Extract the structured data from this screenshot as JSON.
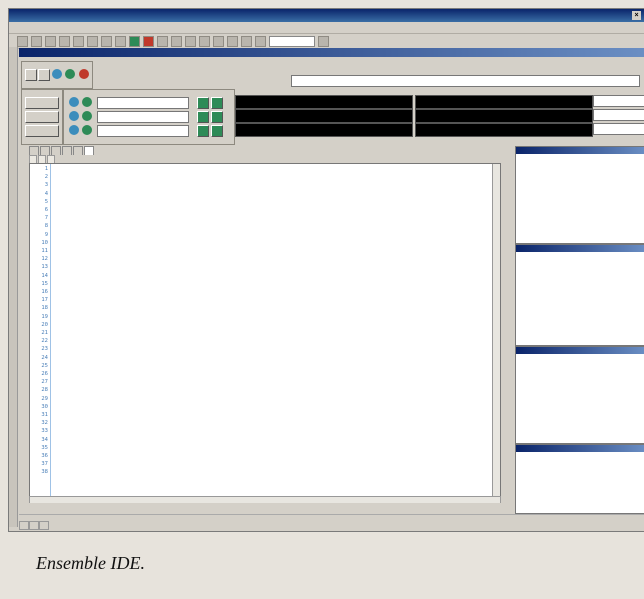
{
  "caption": "Ensemble IDE.",
  "code_lines": [
    {
      "n": "1",
      "code": "",
      "comment": ""
    },
    {
      "n": "2",
      "code": "",
      "comment": ""
    },
    {
      "n": "3",
      "code": "",
      "comment": ""
    },
    {
      "n": "4",
      "code": "",
      "comment": ""
    },
    {
      "n": "5",
      "code": "",
      "comment": ""
    },
    {
      "n": "6",
      "code": "",
      "comment": ""
    },
    {
      "n": "7",
      "code": "",
      "comment": ""
    },
    {
      "n": "8",
      "code": "",
      "comment": ""
    },
    {
      "n": "9",
      "code": "",
      "comment": ""
    },
    {
      "n": "10",
      "code": "",
      "comment": ""
    },
    {
      "n": "11",
      "code": "",
      "comment": ""
    },
    {
      "n": "12",
      "code": "",
      "comment": ""
    },
    {
      "n": "13",
      "code": "",
      "comment": ""
    },
    {
      "n": "14",
      "code": "",
      "comment": ""
    },
    {
      "n": "15",
      "code": "",
      "comment": ""
    },
    {
      "n": "16",
      "code": "",
      "comment": ""
    },
    {
      "n": "17",
      "code": "",
      "comment": ""
    },
    {
      "n": "18",
      "code": "",
      "comment": ""
    },
    {
      "n": "19",
      "code": "",
      "comment": ""
    },
    {
      "n": "20",
      "code": "",
      "comment": ""
    },
    {
      "n": "21",
      "code": "",
      "comment": ""
    },
    {
      "n": "22",
      "code": "",
      "comment": ""
    },
    {
      "n": "23",
      "code": "",
      "comment": ""
    },
    {
      "n": "24",
      "code": "",
      "comment": ""
    },
    {
      "n": "25",
      "code": "",
      "comment": ""
    },
    {
      "n": "26",
      "code": "",
      "comment": ""
    },
    {
      "n": "27",
      "code": "",
      "comment": ""
    },
    {
      "n": "28",
      "code": "",
      "comment": ""
    },
    {
      "n": "29",
      "code": "",
      "comment": ""
    },
    {
      "n": "30",
      "code": "",
      "comment": ""
    },
    {
      "n": "31",
      "code": "",
      "comment": ""
    },
    {
      "n": "32",
      "code": "",
      "comment": ""
    },
    {
      "n": "33",
      "code": "",
      "comment": ""
    },
    {
      "n": "34",
      "code": "",
      "comment": ""
    },
    {
      "n": "35",
      "code": "",
      "comment": ""
    },
    {
      "n": "36",
      "code": "",
      "comment": ""
    },
    {
      "n": "37",
      "code": "",
      "comment": ""
    },
    {
      "n": "38",
      "code": "",
      "comment": ""
    }
  ],
  "colors": {
    "lcd_text": "#ffd400",
    "panel_header": "#0a246a",
    "line_numbers": "#4a7fb8",
    "comment_text": "#1a7a1a"
  },
  "icons": [
    "window-icon",
    "toolbar-icons",
    "run-icon",
    "stop-icon",
    "settings-icon"
  ]
}
